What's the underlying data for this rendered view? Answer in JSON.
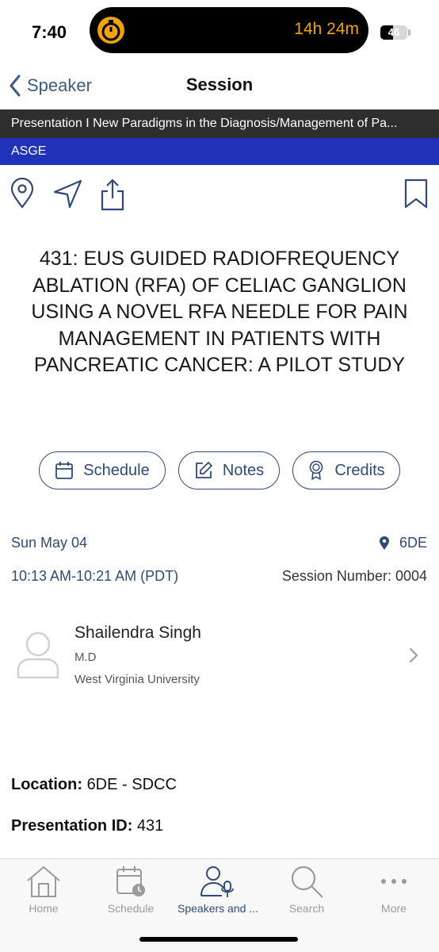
{
  "status": {
    "time": "7:40",
    "island_timer": "14h 24m",
    "battery": "46",
    "battery_level_percent": 46,
    "accent_color": "#f0a30a"
  },
  "nav": {
    "back_label": "Speaker",
    "title": "Session"
  },
  "banners": {
    "session_line": "Presentation I New Paradigms in the Diagnosis/Management of Pa...",
    "organization": "ASGE"
  },
  "actions": {
    "icons": [
      "location-pin-icon",
      "navigate-arrow-icon",
      "share-icon",
      "bookmark-icon"
    ]
  },
  "presentation": {
    "title": "431: EUS GUIDED RADIOFREQUENCY ABLATION (RFA) OF CELIAC GANGLION USING A NOVEL RFA NEEDLE FOR PAIN MANAGEMENT IN PATIENTS WITH PANCREATIC CANCER: A PILOT STUDY"
  },
  "buttons": {
    "schedule": "Schedule",
    "notes": "Notes",
    "credits": "Credits"
  },
  "meta": {
    "date": "Sun May 04",
    "room": "6DE",
    "time": "10:13 AM-10:21 AM (PDT)",
    "session_number": "Session Number: 0004"
  },
  "speaker": {
    "name": "Shailendra Singh",
    "degree": "M.D",
    "organization": "West Virginia University"
  },
  "details": {
    "location_label": "Location:",
    "location_value": "6DE - SDCC",
    "presentation_id_label": "Presentation ID:",
    "presentation_id_value": "431"
  },
  "tabs": [
    {
      "label": "Home",
      "icon": "home-icon"
    },
    {
      "label": "Schedule",
      "icon": "calendar-clock-icon"
    },
    {
      "label": "Speakers and ...",
      "icon": "speaker-mic-icon"
    },
    {
      "label": "Search",
      "icon": "search-icon"
    },
    {
      "label": "More",
      "icon": "more-dots-icon"
    }
  ],
  "colors": {
    "brand_navy": "#2f4a78",
    "banner_dark": "#2e2e2e",
    "banner_blue": "#2032b8"
  }
}
